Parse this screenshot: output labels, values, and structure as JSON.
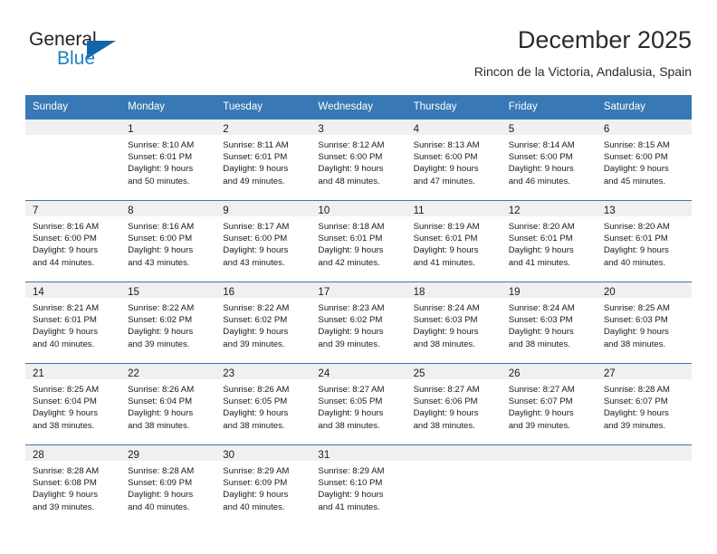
{
  "brand": {
    "name_top": "General",
    "name_bottom": "Blue",
    "color_dark": "#231f20",
    "color_blue": "#1f7fc4",
    "triangle_color": "#1066ab"
  },
  "header": {
    "title": "December 2025",
    "subtitle": "Rincon de la Victoria, Andalusia, Spain"
  },
  "theme": {
    "header_row_bg": "#3878b4",
    "header_row_text": "#ffffff",
    "daynum_band_bg": "#f0f0f0",
    "cell_bg": "#ffffff",
    "grid_line": "#3878b4"
  },
  "calendar": {
    "weekday_headers": [
      "Sunday",
      "Monday",
      "Tuesday",
      "Wednesday",
      "Thursday",
      "Friday",
      "Saturday"
    ],
    "weeks": [
      [
        {
          "day": "",
          "lines": []
        },
        {
          "day": "1",
          "lines": [
            "Sunrise: 8:10 AM",
            "Sunset: 6:01 PM",
            "Daylight: 9 hours",
            "and 50 minutes."
          ]
        },
        {
          "day": "2",
          "lines": [
            "Sunrise: 8:11 AM",
            "Sunset: 6:01 PM",
            "Daylight: 9 hours",
            "and 49 minutes."
          ]
        },
        {
          "day": "3",
          "lines": [
            "Sunrise: 8:12 AM",
            "Sunset: 6:00 PM",
            "Daylight: 9 hours",
            "and 48 minutes."
          ]
        },
        {
          "day": "4",
          "lines": [
            "Sunrise: 8:13 AM",
            "Sunset: 6:00 PM",
            "Daylight: 9 hours",
            "and 47 minutes."
          ]
        },
        {
          "day": "5",
          "lines": [
            "Sunrise: 8:14 AM",
            "Sunset: 6:00 PM",
            "Daylight: 9 hours",
            "and 46 minutes."
          ]
        },
        {
          "day": "6",
          "lines": [
            "Sunrise: 8:15 AM",
            "Sunset: 6:00 PM",
            "Daylight: 9 hours",
            "and 45 minutes."
          ]
        }
      ],
      [
        {
          "day": "7",
          "lines": [
            "Sunrise: 8:16 AM",
            "Sunset: 6:00 PM",
            "Daylight: 9 hours",
            "and 44 minutes."
          ]
        },
        {
          "day": "8",
          "lines": [
            "Sunrise: 8:16 AM",
            "Sunset: 6:00 PM",
            "Daylight: 9 hours",
            "and 43 minutes."
          ]
        },
        {
          "day": "9",
          "lines": [
            "Sunrise: 8:17 AM",
            "Sunset: 6:00 PM",
            "Daylight: 9 hours",
            "and 43 minutes."
          ]
        },
        {
          "day": "10",
          "lines": [
            "Sunrise: 8:18 AM",
            "Sunset: 6:01 PM",
            "Daylight: 9 hours",
            "and 42 minutes."
          ]
        },
        {
          "day": "11",
          "lines": [
            "Sunrise: 8:19 AM",
            "Sunset: 6:01 PM",
            "Daylight: 9 hours",
            "and 41 minutes."
          ]
        },
        {
          "day": "12",
          "lines": [
            "Sunrise: 8:20 AM",
            "Sunset: 6:01 PM",
            "Daylight: 9 hours",
            "and 41 minutes."
          ]
        },
        {
          "day": "13",
          "lines": [
            "Sunrise: 8:20 AM",
            "Sunset: 6:01 PM",
            "Daylight: 9 hours",
            "and 40 minutes."
          ]
        }
      ],
      [
        {
          "day": "14",
          "lines": [
            "Sunrise: 8:21 AM",
            "Sunset: 6:01 PM",
            "Daylight: 9 hours",
            "and 40 minutes."
          ]
        },
        {
          "day": "15",
          "lines": [
            "Sunrise: 8:22 AM",
            "Sunset: 6:02 PM",
            "Daylight: 9 hours",
            "and 39 minutes."
          ]
        },
        {
          "day": "16",
          "lines": [
            "Sunrise: 8:22 AM",
            "Sunset: 6:02 PM",
            "Daylight: 9 hours",
            "and 39 minutes."
          ]
        },
        {
          "day": "17",
          "lines": [
            "Sunrise: 8:23 AM",
            "Sunset: 6:02 PM",
            "Daylight: 9 hours",
            "and 39 minutes."
          ]
        },
        {
          "day": "18",
          "lines": [
            "Sunrise: 8:24 AM",
            "Sunset: 6:03 PM",
            "Daylight: 9 hours",
            "and 38 minutes."
          ]
        },
        {
          "day": "19",
          "lines": [
            "Sunrise: 8:24 AM",
            "Sunset: 6:03 PM",
            "Daylight: 9 hours",
            "and 38 minutes."
          ]
        },
        {
          "day": "20",
          "lines": [
            "Sunrise: 8:25 AM",
            "Sunset: 6:03 PM",
            "Daylight: 9 hours",
            "and 38 minutes."
          ]
        }
      ],
      [
        {
          "day": "21",
          "lines": [
            "Sunrise: 8:25 AM",
            "Sunset: 6:04 PM",
            "Daylight: 9 hours",
            "and 38 minutes."
          ]
        },
        {
          "day": "22",
          "lines": [
            "Sunrise: 8:26 AM",
            "Sunset: 6:04 PM",
            "Daylight: 9 hours",
            "and 38 minutes."
          ]
        },
        {
          "day": "23",
          "lines": [
            "Sunrise: 8:26 AM",
            "Sunset: 6:05 PM",
            "Daylight: 9 hours",
            "and 38 minutes."
          ]
        },
        {
          "day": "24",
          "lines": [
            "Sunrise: 8:27 AM",
            "Sunset: 6:05 PM",
            "Daylight: 9 hours",
            "and 38 minutes."
          ]
        },
        {
          "day": "25",
          "lines": [
            "Sunrise: 8:27 AM",
            "Sunset: 6:06 PM",
            "Daylight: 9 hours",
            "and 38 minutes."
          ]
        },
        {
          "day": "26",
          "lines": [
            "Sunrise: 8:27 AM",
            "Sunset: 6:07 PM",
            "Daylight: 9 hours",
            "and 39 minutes."
          ]
        },
        {
          "day": "27",
          "lines": [
            "Sunrise: 8:28 AM",
            "Sunset: 6:07 PM",
            "Daylight: 9 hours",
            "and 39 minutes."
          ]
        }
      ],
      [
        {
          "day": "28",
          "lines": [
            "Sunrise: 8:28 AM",
            "Sunset: 6:08 PM",
            "Daylight: 9 hours",
            "and 39 minutes."
          ]
        },
        {
          "day": "29",
          "lines": [
            "Sunrise: 8:28 AM",
            "Sunset: 6:09 PM",
            "Daylight: 9 hours",
            "and 40 minutes."
          ]
        },
        {
          "day": "30",
          "lines": [
            "Sunrise: 8:29 AM",
            "Sunset: 6:09 PM",
            "Daylight: 9 hours",
            "and 40 minutes."
          ]
        },
        {
          "day": "31",
          "lines": [
            "Sunrise: 8:29 AM",
            "Sunset: 6:10 PM",
            "Daylight: 9 hours",
            "and 41 minutes."
          ]
        },
        {
          "day": "",
          "lines": []
        },
        {
          "day": "",
          "lines": []
        },
        {
          "day": "",
          "lines": []
        }
      ]
    ]
  }
}
